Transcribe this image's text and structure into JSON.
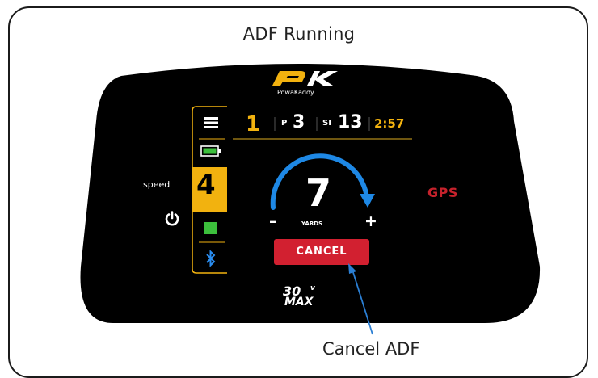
{
  "page": {
    "heading": "ADF Running",
    "caption": "Cancel ADF"
  },
  "display": {
    "brand": "PowaKaddy",
    "hole": "1",
    "par_label": "P",
    "par": "3",
    "si_label": "SI",
    "stroke_index": "13",
    "time": "2:57",
    "speed_label": "speed",
    "speed_value": "4",
    "distance": "7",
    "distance_unit": "YARDS",
    "minus": "–",
    "plus": "+",
    "gps_label": "GPS",
    "cancel_label": "CANCEL",
    "model": "30",
    "model_suffix": "v",
    "model_line2": "MAX"
  },
  "icons": [
    "menu-icon",
    "battery-icon",
    "power-icon",
    "stop-icon",
    "bluetooth-icon",
    "brand-logo-icon"
  ],
  "colors": {
    "screen": "#000000",
    "accent_yellow": "#f2b20f",
    "cancel_red": "#d22030",
    "gps_red": "#c6222c",
    "arc_blue": "#1e88e5",
    "battery_green": "#3cbf3c",
    "bluetooth_blue": "#2a8df0"
  }
}
